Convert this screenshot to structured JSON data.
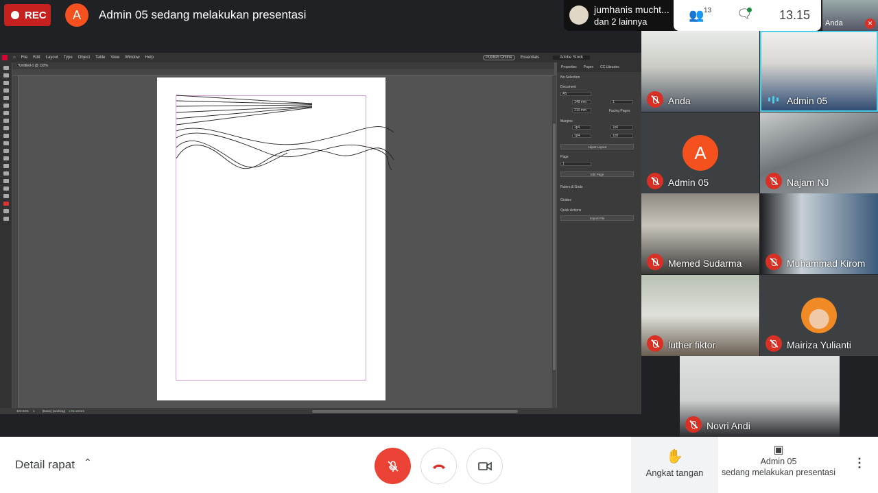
{
  "top": {
    "rec_label": "REC",
    "presenter_initial": "A",
    "presenting_title": "Admin 05 sedang melakukan presentasi",
    "chat_preview": {
      "line1": "jumhanis mucht...",
      "line2": "dan 2 lainnya"
    },
    "participants_count": "13",
    "time": "13.15",
    "self_label": "Anda"
  },
  "indesign": {
    "menu": [
      "File",
      "Edit",
      "Layout",
      "Type",
      "Object",
      "Table",
      "View",
      "Window",
      "Help"
    ],
    "publish_online": "Publish Online",
    "workspace": "Essentials",
    "search_placeholder": "Adobe Stock",
    "doc_tab": "*Untitled-1 @ 122%",
    "panel": {
      "tabs": [
        "Properties",
        "Pages",
        "CC Libraries"
      ],
      "no_selection": "No Selection",
      "document_label": "Document",
      "preset": "A5",
      "width": "148 mm",
      "height": "210 mm",
      "pages_count": "1",
      "facing_pages": "Facing Pages",
      "margins_label": "Margins",
      "margin_top": "1p4",
      "margin_bottom": "1p4",
      "margin_inside": "1p0",
      "margin_outside": "1p0",
      "adjust_layout": "Adjust Layout",
      "page_label": "Page",
      "page_value": "1",
      "edit_page": "Edit Page",
      "rulers_grids": "Rulers & Grids",
      "guides": "Guides",
      "quick_actions": "Quick Actions",
      "import_file": "Import File"
    },
    "status": {
      "zoom": "122.04%",
      "page": "1",
      "style": "[Basic] (working)",
      "errors": "No errors"
    }
  },
  "participants": [
    {
      "name": "Anda",
      "muted": true
    },
    {
      "name": "Admin 05",
      "muted": false,
      "speaking": true
    },
    {
      "name": "Admin 05",
      "muted": true,
      "initial": "A"
    },
    {
      "name": "Najam NJ",
      "muted": true
    },
    {
      "name": "Memed Sudarma",
      "muted": true
    },
    {
      "name": "Muhammad Kirom",
      "muted": true
    },
    {
      "name": "luther fiktor",
      "muted": true
    },
    {
      "name": "Mairiza Yulianti",
      "muted": true
    },
    {
      "name": "Novri Andi",
      "muted": true
    }
  ],
  "bottom": {
    "meeting_details": "Detail rapat",
    "raise_hand": "Angkat tangan",
    "presenting_line1": "Admin 05",
    "presenting_line2": "sedang melakukan presentasi"
  },
  "colors": {
    "accent_red": "#ea4335",
    "rec_red": "#c5221f",
    "avatar_orange": "#f4511e"
  }
}
